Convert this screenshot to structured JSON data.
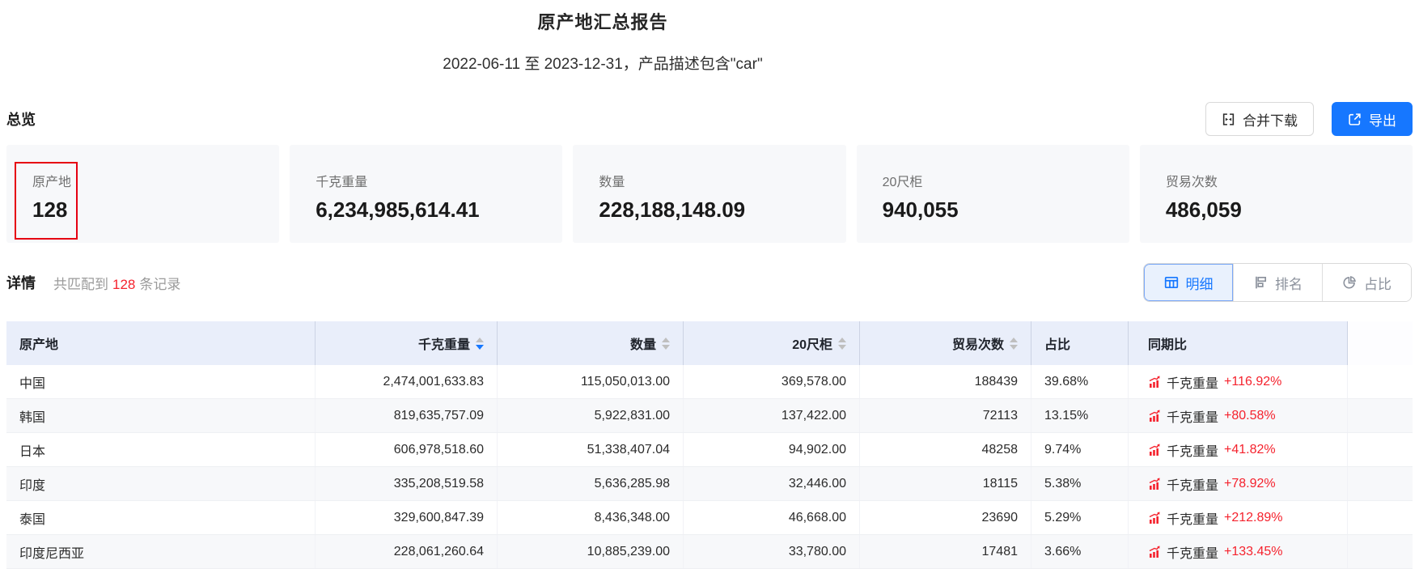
{
  "page": {
    "title": "原产地汇总报告",
    "subtitle": "2022-06-11 至 2023-12-31，产品描述包含\"car\""
  },
  "overview": {
    "heading": "总览",
    "merge_download_label": "合并下载",
    "export_label": "导出",
    "cards": [
      {
        "label": "原产地",
        "value": "128",
        "highlighted": true
      },
      {
        "label": "千克重量",
        "value": "6,234,985,614.41"
      },
      {
        "label": "数量",
        "value": "228,188,148.09"
      },
      {
        "label": "20尺柜",
        "value": "940,055"
      },
      {
        "label": "贸易次数",
        "value": "486,059"
      }
    ]
  },
  "details": {
    "heading": "详情",
    "match_prefix": "共匹配到",
    "match_count": "128",
    "match_suffix": "条记录",
    "tabs": [
      {
        "label": "明细",
        "icon": "table-icon",
        "active": true
      },
      {
        "label": "排名",
        "icon": "ranking-icon",
        "active": false
      },
      {
        "label": "占比",
        "icon": "pie-chart-icon",
        "active": false
      }
    ]
  },
  "table": {
    "columns": [
      {
        "label": "原产地",
        "sortable": false
      },
      {
        "label": "千克重量",
        "sortable": true,
        "sort": "desc"
      },
      {
        "label": "数量",
        "sortable": true,
        "sort": null
      },
      {
        "label": "20尺柜",
        "sortable": true,
        "sort": null
      },
      {
        "label": "贸易次数",
        "sortable": true,
        "sort": null
      },
      {
        "label": "占比",
        "sortable": false
      },
      {
        "label": "同期比",
        "sortable": false
      }
    ],
    "rows": [
      {
        "origin": "中国",
        "weight": "2,474,001,633.83",
        "quantity": "115,050,013.00",
        "containers": "369,578.00",
        "trades": "188439",
        "share": "39.68%",
        "yoy_label": "千克重量",
        "yoy_value": "+116.92%"
      },
      {
        "origin": "韩国",
        "weight": "819,635,757.09",
        "quantity": "5,922,831.00",
        "containers": "137,422.00",
        "trades": "72113",
        "share": "13.15%",
        "yoy_label": "千克重量",
        "yoy_value": "+80.58%"
      },
      {
        "origin": "日本",
        "weight": "606,978,518.60",
        "quantity": "51,338,407.04",
        "containers": "94,902.00",
        "trades": "48258",
        "share": "9.74%",
        "yoy_label": "千克重量",
        "yoy_value": "+41.82%"
      },
      {
        "origin": "印度",
        "weight": "335,208,519.58",
        "quantity": "5,636,285.98",
        "containers": "32,446.00",
        "trades": "18115",
        "share": "5.38%",
        "yoy_label": "千克重量",
        "yoy_value": "+78.92%"
      },
      {
        "origin": "泰国",
        "weight": "329,600,847.39",
        "quantity": "8,436,348.00",
        "containers": "46,668.00",
        "trades": "23690",
        "share": "5.29%",
        "yoy_label": "千克重量",
        "yoy_value": "+212.89%"
      },
      {
        "origin": "印度尼西亚",
        "weight": "228,061,260.64",
        "quantity": "10,885,239.00",
        "containers": "33,780.00",
        "trades": "17481",
        "share": "3.66%",
        "yoy_label": "千克重量",
        "yoy_value": "+133.45%"
      }
    ]
  },
  "colors": {
    "accent_blue": "#1677ff",
    "annotation_red": "#e60012",
    "negative_red": "#f5222d",
    "header_bg": "#e9eefa",
    "card_bg": "#f7f8fa"
  },
  "icons": {
    "merge_download": "merge-cells-icon",
    "export": "export-icon",
    "tab_detail": "table-icon",
    "tab_ranking": "ranking-icon",
    "tab_share": "pie-chart-icon",
    "yoy_trend": "trend-up-icon"
  }
}
